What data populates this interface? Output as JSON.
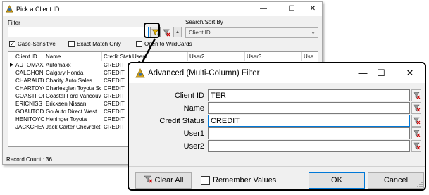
{
  "bg_window": {
    "title": "Pick a Client ID",
    "controls": {
      "minimize": "—",
      "maximize": "☐",
      "close": "✕"
    },
    "filter_label": "Filter",
    "filter_value": "",
    "search_label": "Search/Sort By",
    "search_value": "Client ID",
    "checkboxes": [
      {
        "label": "Case-Sensitive",
        "checked": true
      },
      {
        "label": "Exact Match Only",
        "checked": false
      },
      {
        "label": "Open to WildCards",
        "checked": false
      }
    ],
    "grid_headers": [
      "Client ID",
      "Name",
      "Credit Status",
      "User1",
      "User2",
      "User3",
      "Use"
    ],
    "rows": [
      {
        "id": "AUTOMAXX",
        "name": "Automaxx",
        "status": "CREDIT",
        "current": true
      },
      {
        "id": "CALGHOND",
        "name": "Calgary Honda",
        "status": "CREDIT"
      },
      {
        "id": "CHARAUTO",
        "name": "Charity Auto Sales",
        "status": "CREDIT"
      },
      {
        "id": "CHARTOYO",
        "name": "Charlesglen Toyota Scio",
        "status": "CREDIT"
      },
      {
        "id": "COASTFOR",
        "name": "Coastal Ford Vancouver",
        "status": "CREDIT"
      },
      {
        "id": "ERICNISS",
        "name": "Ericksen Nissan",
        "status": "CREDIT"
      },
      {
        "id": "GOAUTODI",
        "name": "Go Auto Direct West",
        "status": "CREDIT"
      },
      {
        "id": "HENITOYO",
        "name": "Heninger Toyota",
        "status": "CREDIT"
      },
      {
        "id": "JACKCHEV",
        "name": "Jack Carter Chevrolet",
        "status": "CREDIT"
      }
    ],
    "record_count": "Record Count : 36"
  },
  "dialog": {
    "title": "Advanced (Multi-Column) Filter",
    "controls": {
      "minimize": "—",
      "maximize": "☐",
      "close": "✕"
    },
    "fields": [
      {
        "label": "Client ID",
        "value": "TER"
      },
      {
        "label": "Name",
        "value": ""
      },
      {
        "label": "Credit Status",
        "value": "CREDIT"
      },
      {
        "label": "User1",
        "value": ""
      },
      {
        "label": "User2",
        "value": ""
      }
    ],
    "clear_all": "Clear All",
    "remember_values": "Remember Values",
    "ok": "OK",
    "cancel": "Cancel"
  },
  "colors": {
    "accent": "#0078d7",
    "callout": "#000000"
  },
  "icons": [
    "app-icon",
    "filter-icon",
    "clear-filter-icon",
    "minimize-icon",
    "maximize-icon",
    "close-icon",
    "resize-grip-icon"
  ]
}
